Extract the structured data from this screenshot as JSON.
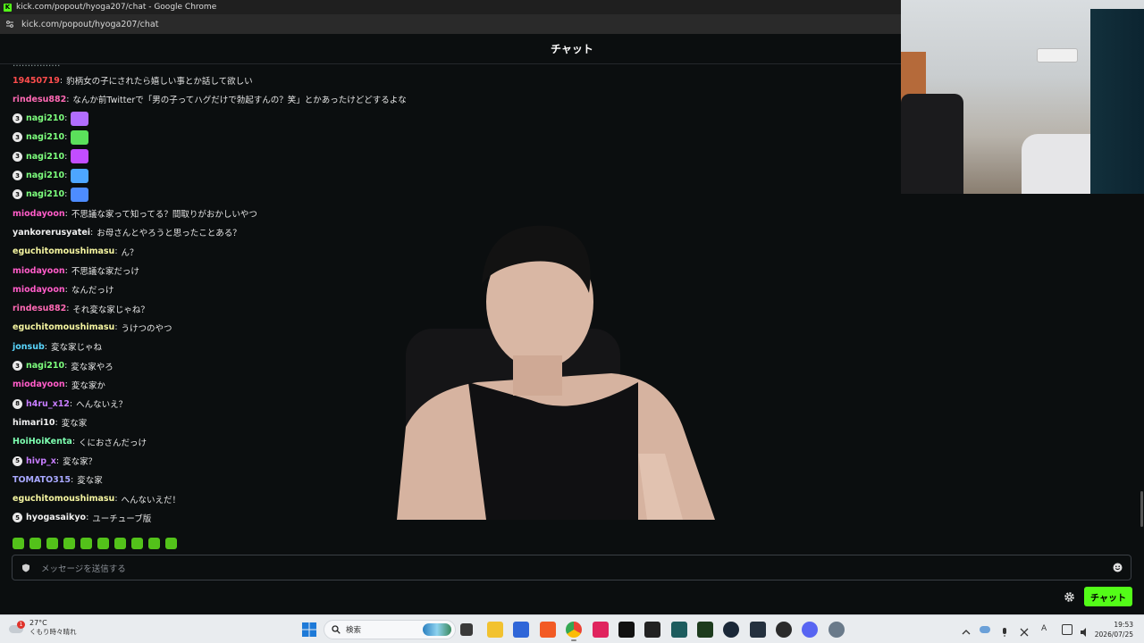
{
  "browser": {
    "title": "kick.com/popout/hyoga207/chat - Google Chrome",
    "url": "kick.com/popout/hyoga207/chat",
    "favicon_letter": "K"
  },
  "chat": {
    "header": "チャット",
    "messages": [
      {
        "user": "19450719",
        "color": "#ff4d4d",
        "text": "豹柄女の子にされたら嬉しい事とか話して欲しい"
      },
      {
        "user": "rindesu882",
        "color": "#ff69b4",
        "text": "なんか前Twitterで「男の子ってハグだけで勃起すんの？笑」とかあったけどどするよな"
      },
      {
        "badge": "3",
        "user": "nagi210",
        "color": "#7dff7d",
        "emote": "#b26dff"
      },
      {
        "badge": "3",
        "user": "nagi210",
        "color": "#7dff7d",
        "emote": "#5be05b"
      },
      {
        "badge": "3",
        "user": "nagi210",
        "color": "#7dff7d",
        "emote": "#c24dff"
      },
      {
        "badge": "3",
        "user": "nagi210",
        "color": "#7dff7d",
        "emote": "#4da6ff"
      },
      {
        "badge": "3",
        "user": "nagi210",
        "color": "#7dff7d",
        "emote": "#4d8cff"
      },
      {
        "user": "miodayoon",
        "color": "#ff5cc8",
        "text": "不思議な家って知ってる？間取りがおかしいやつ"
      },
      {
        "user": "yankorerusyatei",
        "color": "#f0f0f0",
        "text": "お母さんとやろうと思ったことある？"
      },
      {
        "user": "eguchitomoushimasu",
        "color": "#f5f5a0",
        "text": "ん？"
      },
      {
        "user": "miodayoon",
        "color": "#ff5cc8",
        "text": "不思議な家だっけ"
      },
      {
        "user": "miodayoon",
        "color": "#ff5cc8",
        "text": "なんだっけ"
      },
      {
        "user": "rindesu882",
        "color": "#ff69b4",
        "text": "それ変な家じゃね？"
      },
      {
        "user": "eguchitomoushimasu",
        "color": "#f5f5a0",
        "text": "うけつのやつ"
      },
      {
        "user": "jonsub",
        "color": "#5ad7ff",
        "text": "変な家じゃね"
      },
      {
        "badge": "3",
        "user": "nagi210",
        "color": "#7dff7d",
        "text": "変な家やろ"
      },
      {
        "user": "miodayoon",
        "color": "#ff5cc8",
        "text": "変な家か"
      },
      {
        "badge": "8",
        "user": "h4ru_x12",
        "color": "#c77dff",
        "text": "へんないえ？"
      },
      {
        "user": "himari10",
        "color": "#f0f0f0",
        "text": "変な家"
      },
      {
        "user": "HoiHoiKenta",
        "color": "#7dffb0",
        "text": "くにおさんだっけ"
      },
      {
        "badge": "5",
        "user": "hivp_x",
        "color": "#c77dff",
        "text": "変な家？"
      },
      {
        "user": "TOMATO315",
        "color": "#a8a8ff",
        "text": "変な家"
      },
      {
        "user": "eguchitomoushimasu",
        "color": "#f5f5a0",
        "text": "へんないえだ！"
      },
      {
        "badge": "5",
        "user": "hyogasaikyo",
        "color": "#f0f0f0",
        "text": "ユーチューブ版"
      }
    ],
    "input_placeholder": "メッセージを送信する",
    "send_label": "チャット"
  },
  "taskbar": {
    "temperature": "27°C",
    "condition": "くもり時々晴れ",
    "weather_badge": "1",
    "search_placeholder": "検索",
    "time": "19:53",
    "date": "2026/07/25",
    "accent_color": "#53fc18"
  }
}
